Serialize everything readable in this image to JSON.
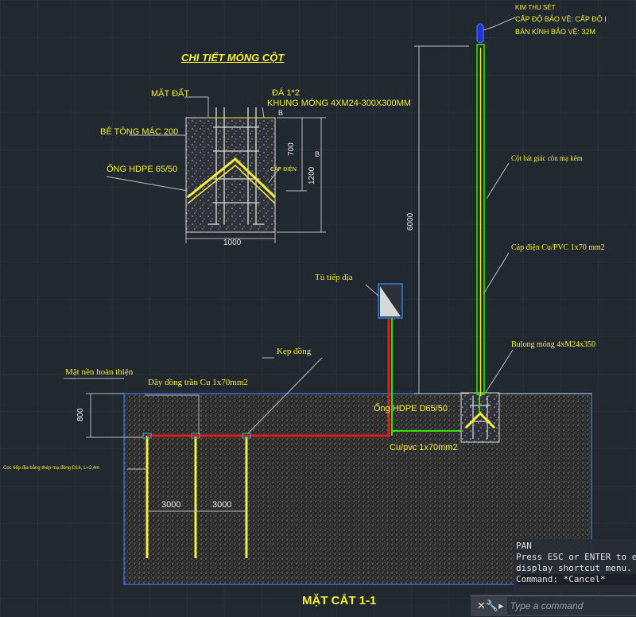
{
  "drawing": {
    "detail_title": "CHI TIẾT MÓNG CỘT",
    "detail_labels": {
      "ground": "MẶT ĐẤT",
      "stone": "ĐÁ 1*2",
      "frame": "KHUNG MÓNG 4XM24-300X300MM",
      "concrete": "BÊ TÔNG MÁC 200",
      "pipe": "ỐNG HDPE 65/50",
      "cable": "CÁP ĐIỆN",
      "dim_700": "700",
      "dim_1200": "1200",
      "dim_1000": "1000",
      "tag_b1": "B",
      "tag_b2": "B"
    },
    "lightning_rod": {
      "name": "KIM THU SÉT",
      "level": "CẤP ĐỘ BẢO VỆ: CẤP ĐỘ I",
      "radius": "BÁN KÍNH BẢO VỆ: 32M"
    },
    "pole_labels": {
      "pole": "Cột bát giác côn mạ kẽm",
      "cable": "Cáp điện Cu/PVC 1x70 mm2",
      "bolt": "Bulong móng 4xM24x350",
      "height": "6000"
    },
    "grounding": {
      "box": "Tủ tiếp địa",
      "clamp": "Kẹp đồng",
      "finished_floor": "Mặt nền hoàn thiện",
      "copper_wire": "Dây đồng trần Cu 1x70mm2",
      "hdpe_pipe": "Ống HDPE D65/50",
      "cu_pvc": "Cu/pvc 1x70mm2",
      "rod_note": "Cọc tiếp địa bằng thép mạ đồng D16, L=2,4m",
      "dim_800": "800",
      "dim_3000_a": "3000",
      "dim_3000_b": "3000"
    },
    "section_title": "MẶT CẮT 1-1"
  },
  "command": {
    "history_title": "PAN",
    "history_line1": "Press ESC or ENTER to e",
    "history_line2": "display shortcut menu.",
    "history_line3": "Command: *Cancel*",
    "placeholder": "Type a command",
    "close_icon": "close-icon",
    "wrench_icon": "customize-icon",
    "search_icon": "recent-commands-icon"
  },
  "colors": {
    "background": "#212830",
    "yellow": "#f2ee3a",
    "green": "#2fe000",
    "red": "#e21b1b",
    "cyan": "#2fb6c8",
    "blue": "#2a4dff"
  }
}
